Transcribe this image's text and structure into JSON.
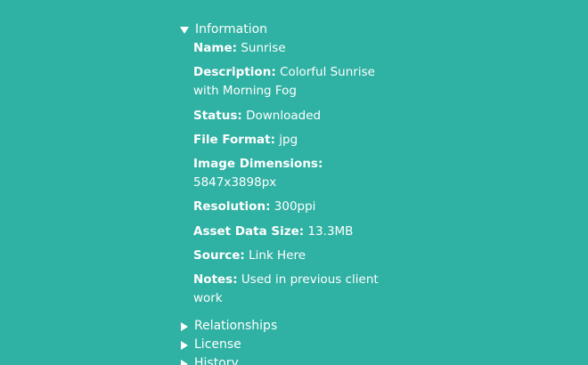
{
  "info": {
    "title": "Information",
    "name_label": "Name:",
    "name_value": "Sunrise",
    "description_label": "Description:",
    "description_value": "Colorful Sunrise with Morning Fog",
    "status_label": "Status:",
    "status_value": "Downloaded",
    "format_label": "File Format:",
    "format_value": "jpg",
    "dimensions_label": "Image Dimensions:",
    "dimensions_value": "5847x3898px",
    "resolution_label": "Resolution:",
    "resolution_value": "300ppi",
    "size_label": "Asset Data Size:",
    "size_value": "13.3MB",
    "source_label": "Source:",
    "source_value": "Link Here",
    "notes_label": "Notes:",
    "notes_value": "Used in previous client work"
  },
  "sections": {
    "relationships": "Relationships",
    "license": "License",
    "history": "History"
  },
  "icons": {
    "expanded": "triangle-down-icon",
    "collapsed": "triangle-right-icon"
  },
  "colors": {
    "background": "#2fb1a3",
    "text": "#ffffff"
  }
}
